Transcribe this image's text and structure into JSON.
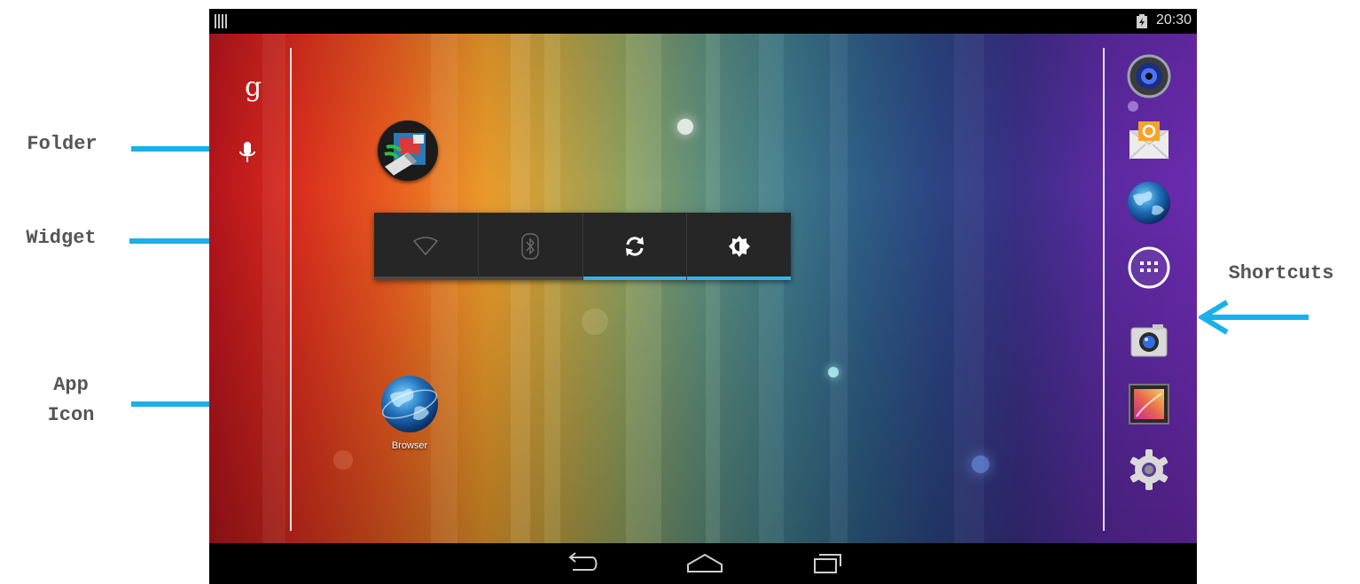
{
  "annotations": {
    "folder": "Folder",
    "widget": "Widget",
    "app_icon_line1": "App",
    "app_icon_line2": "Icon",
    "shortcuts": "Shortcuts",
    "arrow_color": "#1ab0ea"
  },
  "status_bar": {
    "time": "20:30",
    "icons": [
      "notification-bars-icon",
      "battery-icon"
    ]
  },
  "search_bar": {
    "google_label": "g",
    "icons": [
      "google-search-icon",
      "microphone-icon"
    ]
  },
  "home": {
    "folder": {
      "icon": "folder-icon"
    },
    "widget": {
      "name": "power-control-widget",
      "toggles": [
        {
          "icon": "wifi-icon",
          "state": "off"
        },
        {
          "icon": "bluetooth-icon",
          "state": "off"
        },
        {
          "icon": "sync-icon",
          "state": "on"
        },
        {
          "icon": "brightness-icon",
          "state": "on"
        }
      ],
      "accent": "#33b5e5"
    },
    "apps": [
      {
        "label": "Browser",
        "icon": "browser-globe-icon"
      }
    ]
  },
  "dock": {
    "items": [
      "music-speaker-icon",
      "email-icon",
      "browser-globe-icon",
      "all-apps-icon",
      "camera-icon",
      "gallery-icon",
      "settings-gear-icon"
    ]
  },
  "nav_bar": {
    "buttons": [
      "back-icon",
      "home-icon",
      "recents-icon"
    ]
  }
}
